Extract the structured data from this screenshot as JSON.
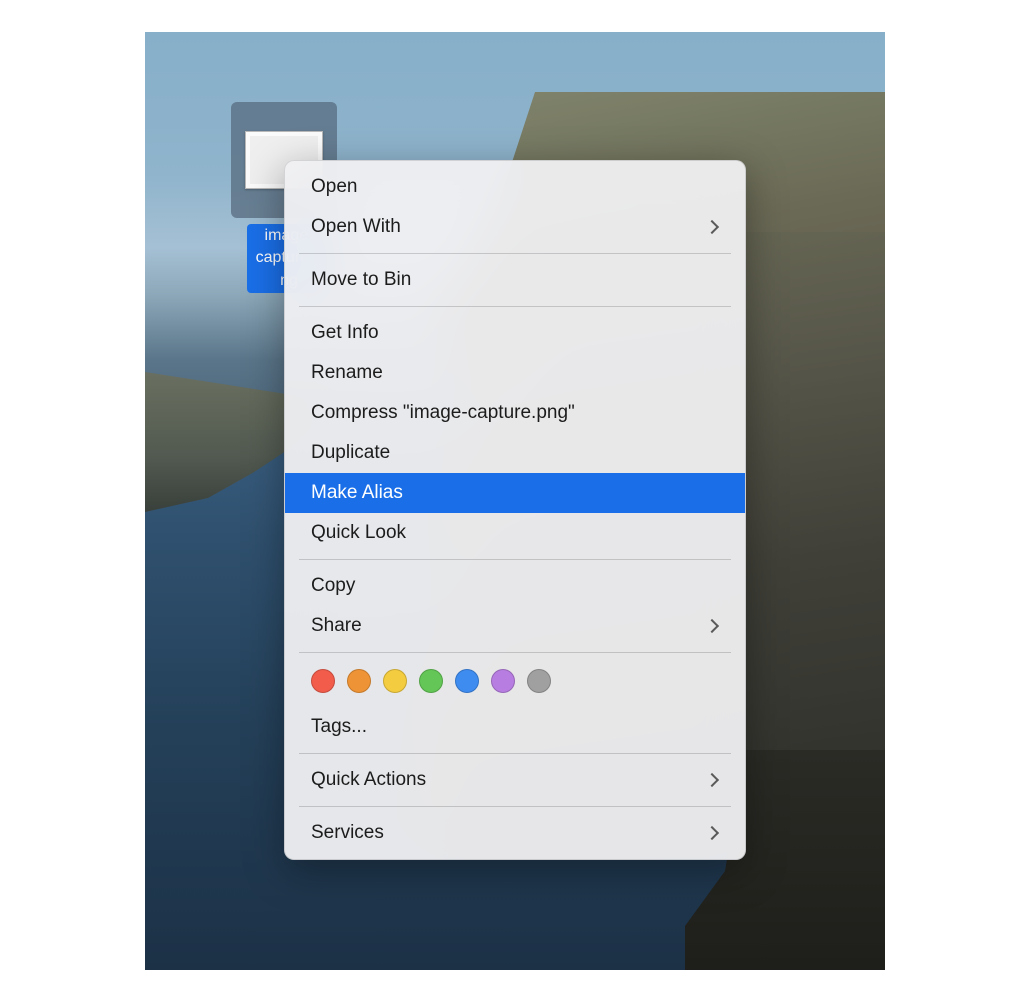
{
  "desktop": {
    "selected_file": {
      "label": "image-capture.png"
    }
  },
  "context_menu": {
    "items": [
      {
        "label": "Open",
        "submenu": false
      },
      {
        "label": "Open With",
        "submenu": true
      }
    ],
    "bin": {
      "label": "Move to Bin"
    },
    "info_group": [
      {
        "label": "Get Info"
      },
      {
        "label": "Rename"
      },
      {
        "label": "Compress \"image-capture.png\""
      },
      {
        "label": "Duplicate"
      },
      {
        "label": "Make Alias",
        "highlighted": true
      },
      {
        "label": "Quick Look"
      }
    ],
    "copy": {
      "label": "Copy"
    },
    "share": {
      "label": "Share",
      "submenu": true
    },
    "tags_label": "Tags...",
    "tag_colors": [
      "#f15c4b",
      "#ef9436",
      "#f3cc3f",
      "#63c656",
      "#3e8cf0",
      "#b77de0",
      "#a0a0a0"
    ],
    "quick_actions": {
      "label": "Quick Actions",
      "submenu": true
    },
    "services": {
      "label": "Services",
      "submenu": true
    }
  }
}
